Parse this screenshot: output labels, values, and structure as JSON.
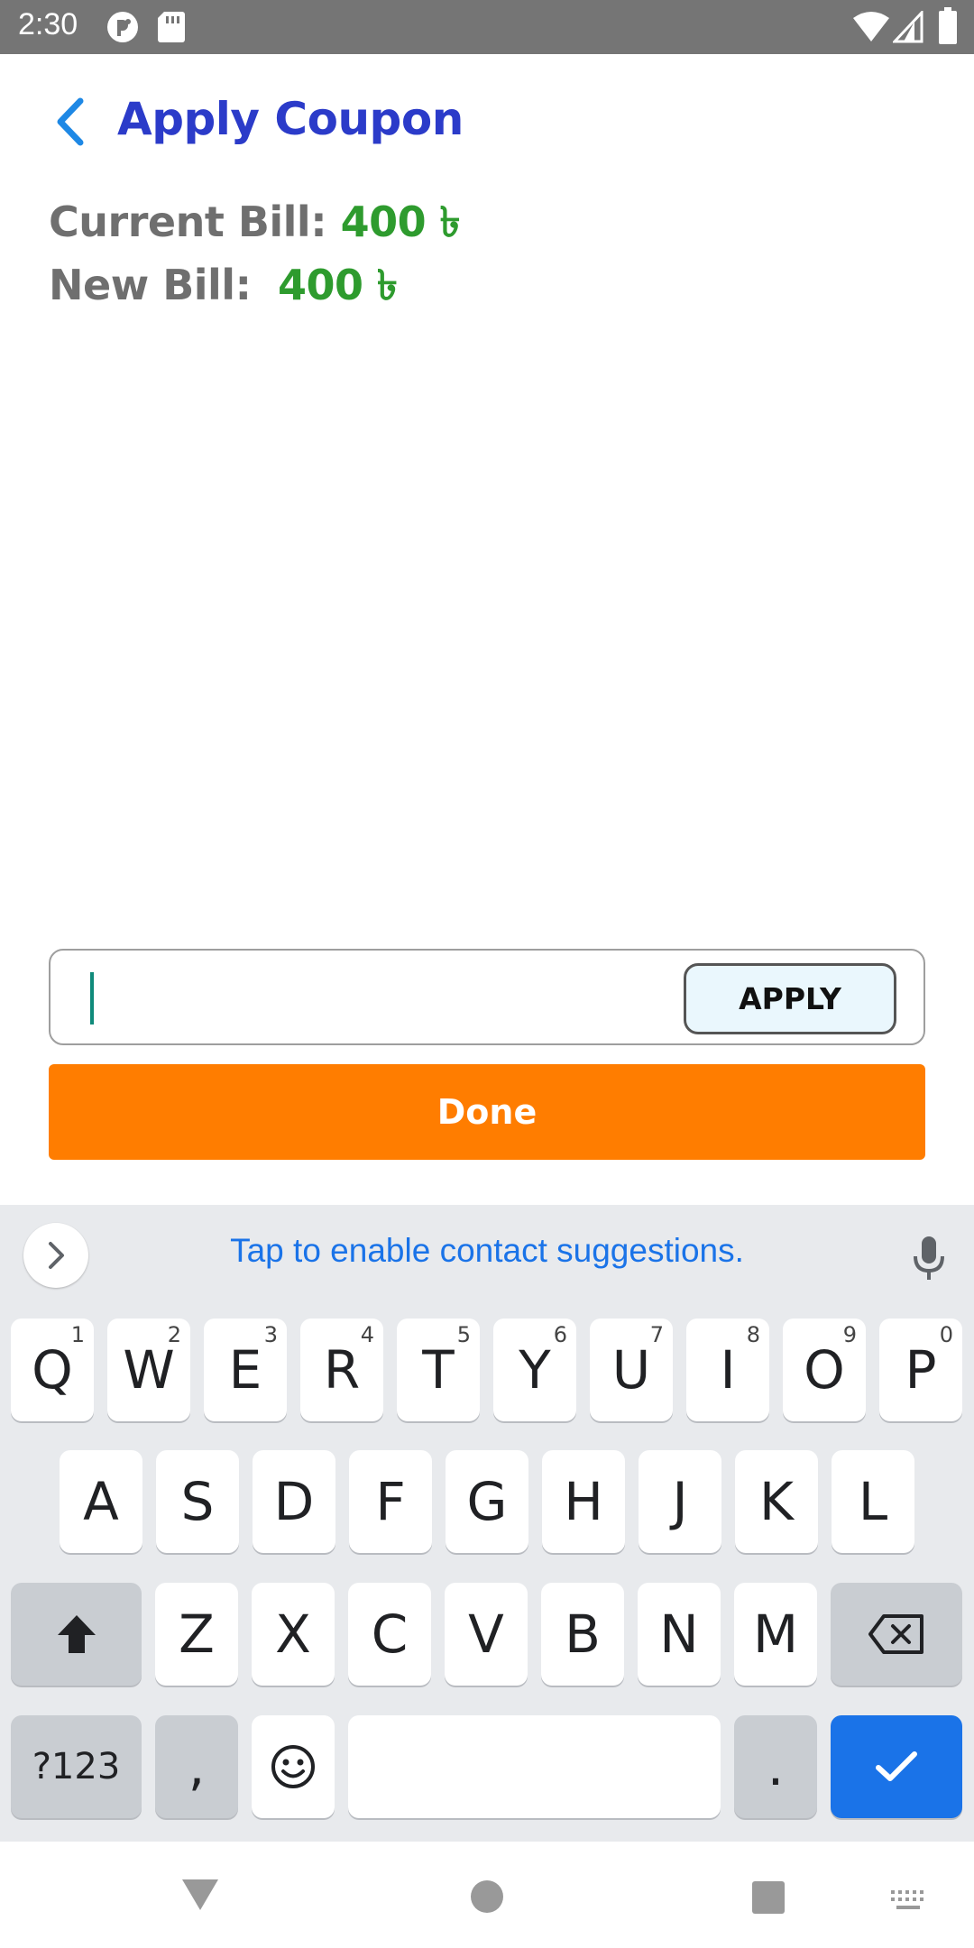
{
  "status_bar": {
    "time": "2:30",
    "icons": [
      "notification-app-icon",
      "sd-card-icon",
      "wifi-icon",
      "signal-icon",
      "battery-icon"
    ]
  },
  "header": {
    "title": "Apply Coupon",
    "back_icon": "chevron-left-icon"
  },
  "bill": {
    "current_label": "Current Bill:",
    "current_value": "400 ৳",
    "new_label": "New Bill:",
    "new_value": "400 ৳"
  },
  "coupon": {
    "input_value": "",
    "apply_label": "APPLY"
  },
  "done_label": "Done",
  "keyboard": {
    "suggestion_text": "Tap to enable contact suggestions.",
    "row1": [
      {
        "label": "Q",
        "hint": "1"
      },
      {
        "label": "W",
        "hint": "2"
      },
      {
        "label": "E",
        "hint": "3"
      },
      {
        "label": "R",
        "hint": "4"
      },
      {
        "label": "T",
        "hint": "5"
      },
      {
        "label": "Y",
        "hint": "6"
      },
      {
        "label": "U",
        "hint": "7"
      },
      {
        "label": "I",
        "hint": "8"
      },
      {
        "label": "O",
        "hint": "9"
      },
      {
        "label": "P",
        "hint": "0"
      }
    ],
    "row2": [
      "A",
      "S",
      "D",
      "F",
      "G",
      "H",
      "J",
      "K",
      "L"
    ],
    "row3": [
      "Z",
      "X",
      "C",
      "V",
      "B",
      "N",
      "M"
    ],
    "row4": {
      "symbols": "?123",
      "comma": ",",
      "period": "."
    },
    "colors": {
      "background": "#e8eaed",
      "accent": "#1a73e8"
    }
  },
  "colors": {
    "title": "#2b3bc9",
    "bill_value": "#2e9b2e",
    "done_button": "#ff7d00",
    "apply_button_bg": "#eaf7fd"
  }
}
